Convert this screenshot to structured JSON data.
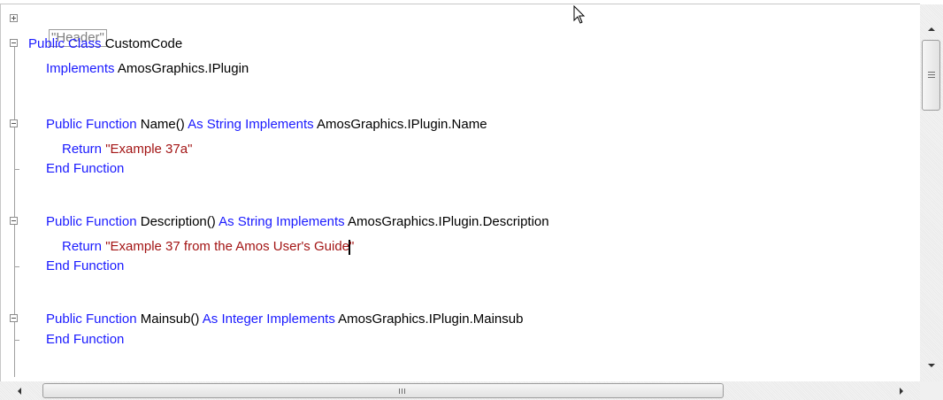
{
  "editor": {
    "header_region": "\"Header\"",
    "lines": {
      "l1": {
        "kw1": "Public Class ",
        "id1": "CustomCode"
      },
      "l2": {
        "kw1": "Implements ",
        "id1": "AmosGraphics.IPlugin"
      },
      "l3": {
        "kw1": "Public Function ",
        "id1": "Name() ",
        "kw2": "As String Implements ",
        "id2": "AmosGraphics.IPlugin.Name"
      },
      "l4": {
        "kw1": "Return ",
        "str1": "\"Example 37a\""
      },
      "l5": {
        "kw1": "End Function"
      },
      "l6": {
        "kw1": "Public Function ",
        "id1": "Description() ",
        "kw2": "As String Implements ",
        "id2": "AmosGraphics.IPlugin.Description"
      },
      "l7": {
        "kw1": "Return ",
        "str1": "\"Example 37 from the Amos User's Guide",
        "str2": "\""
      },
      "l8": {
        "kw1": "End Function"
      },
      "l9": {
        "kw1": "Public Function ",
        "id1": "Mainsub() ",
        "kw2": "As Integer Implements ",
        "id2": "AmosGraphics.IPlugin.Mainsub"
      },
      "l10": {
        "kw1": "End Function"
      }
    }
  },
  "colors": {
    "keyword": "#1a1aff",
    "string": "#a31515",
    "identifier": "#000000",
    "region": "#808080"
  },
  "icons": [
    "expand-plus-icon",
    "collapse-minus-icon",
    "mouse-pointer-icon",
    "scroll-up-arrow-icon",
    "scroll-down-arrow-icon",
    "scroll-left-arrow-icon",
    "scroll-right-arrow-icon"
  ]
}
